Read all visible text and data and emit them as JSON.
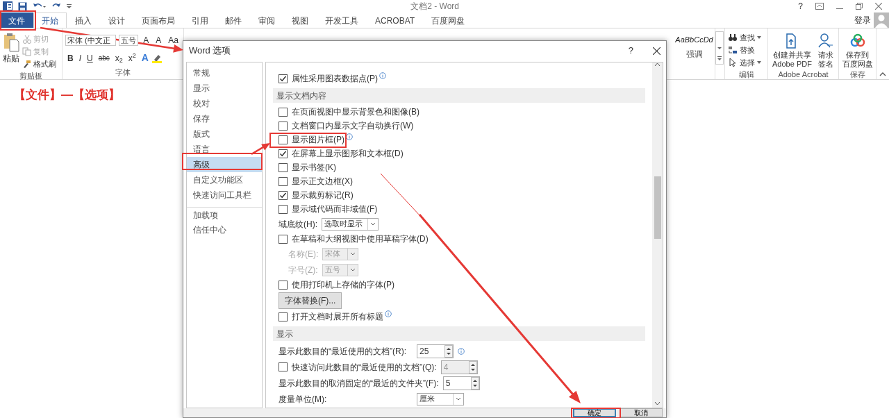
{
  "title_bar": {
    "title": "文档2 - Word",
    "help": "?"
  },
  "ribbon_tabs": [
    {
      "label": "文件",
      "kind": "file",
      "selected": false
    },
    {
      "label": "开始",
      "kind": "tab",
      "selected": true
    },
    {
      "label": "插入",
      "kind": "tab",
      "selected": false
    },
    {
      "label": "设计",
      "kind": "tab",
      "selected": false
    },
    {
      "label": "页面布局",
      "kind": "tab",
      "selected": false
    },
    {
      "label": "引用",
      "kind": "tab",
      "selected": false
    },
    {
      "label": "邮件",
      "kind": "tab",
      "selected": false
    },
    {
      "label": "审阅",
      "kind": "tab",
      "selected": false
    },
    {
      "label": "视图",
      "kind": "tab",
      "selected": false
    },
    {
      "label": "开发工具",
      "kind": "tab",
      "selected": false
    },
    {
      "label": "ACROBAT",
      "kind": "tab",
      "selected": false
    },
    {
      "label": "百度网盘",
      "kind": "tab",
      "selected": false
    }
  ],
  "account": {
    "label": "登录"
  },
  "clipboard": {
    "paste": "粘贴",
    "items": [
      {
        "label": "剪切",
        "disabled": true
      },
      {
        "label": "复制",
        "disabled": true
      },
      {
        "label": "格式刷",
        "disabled": false
      }
    ],
    "group": "剪贴板"
  },
  "font": {
    "name": "宋体 (中文正",
    "size": "五号",
    "size_buttons": [
      "A",
      "A",
      "Aa"
    ],
    "format_buttons": [
      "B",
      "I",
      "U",
      "abc",
      "x$_{2}$",
      "x$^{2}$",
      "A"
    ],
    "group": "字体"
  },
  "styles": {
    "sample": "AaBbCcDd",
    "name": "强调"
  },
  "editing": {
    "items": [
      "查找",
      "替换",
      "选择"
    ],
    "group": "编辑"
  },
  "acrobat": {
    "items": [
      {
        "lines": [
          "创建并共享",
          "Adobe PDF"
        ]
      },
      {
        "lines": [
          "请求",
          "签名"
        ]
      }
    ],
    "group": "Adobe Acrobat"
  },
  "save": {
    "lines": [
      "保存到",
      "百度网盘"
    ],
    "group": "保存"
  },
  "document": {
    "text": "【文件】—【选项】"
  },
  "dialog": {
    "title": "Word 选项",
    "help": "?",
    "nav": [
      {
        "label": "常规",
        "selected": false
      },
      {
        "label": "显示",
        "selected": false
      },
      {
        "label": "校对",
        "selected": false
      },
      {
        "label": "保存",
        "selected": false
      },
      {
        "label": "版式",
        "selected": false
      },
      {
        "label": "语言",
        "selected": false
      },
      {
        "label": "高级",
        "selected": true
      },
      {
        "label": "自定义功能区",
        "selected": false
      },
      {
        "label": "快速访问工具栏",
        "selected": false
      },
      {
        "label": "加载项",
        "selected": false,
        "divider_before": true
      },
      {
        "label": "信任中心",
        "selected": false
      }
    ],
    "sections": [
      {
        "rows": [
          {
            "kind": "checkbox",
            "label": "属性采用图表数据点(P)",
            "checked": true,
            "info": true
          }
        ]
      },
      {
        "title": "显示文档内容",
        "rows": [
          {
            "kind": "checkbox",
            "label": "在页面视图中显示背景色和图像(B)",
            "checked": false
          },
          {
            "kind": "checkbox",
            "label": "文档窗口内显示文字自动换行(W)",
            "checked": false
          },
          {
            "kind": "checkbox",
            "label": "显示图片框(P)",
            "checked": false,
            "info": true
          },
          {
            "kind": "checkbox",
            "label": "在屏幕上显示图形和文本框(D)",
            "checked": true
          },
          {
            "kind": "checkbox",
            "label": "显示书签(K)",
            "checked": false
          },
          {
            "kind": "checkbox",
            "label": "显示正文边框(X)",
            "checked": false
          },
          {
            "kind": "checkbox",
            "label": "显示裁剪标记(R)",
            "checked": true
          },
          {
            "kind": "checkbox",
            "label": "显示域代码而非域值(F)",
            "checked": false
          },
          {
            "kind": "select",
            "label": "域底纹(H):",
            "value": "选取时显示",
            "disabled": false
          },
          {
            "kind": "checkbox",
            "label": "在草稿和大纲视图中使用草稿字体(D)",
            "checked": false,
            "children": [
              {
                "kind": "select",
                "label": "名称(E):",
                "value": "宋体",
                "disabled": true
              },
              {
                "kind": "select",
                "label": "字号(Z):",
                "value": "五号",
                "disabled": true
              }
            ]
          },
          {
            "kind": "checkbox",
            "label": "使用打印机上存储的字体(P)",
            "checked": false
          },
          {
            "kind": "button",
            "label": "字体替换(F)..."
          },
          {
            "kind": "checkbox",
            "label": "打开文档时展开所有标题",
            "checked": false,
            "info": true
          }
        ]
      },
      {
        "title": "显示",
        "rows": [
          {
            "kind": "spin",
            "label": "显示此数目的“最近使用的文档”(R):",
            "value": "25",
            "disabled": false,
            "info": true
          },
          {
            "kind": "spin",
            "label": "快速访问此数目的“最近使用的文档”(Q):",
            "value": "4",
            "disabled": true,
            "checked": false
          },
          {
            "kind": "spin",
            "label": "显示此数目的取消固定的“最近的文件夹”(F):",
            "value": "5",
            "disabled": false
          },
          {
            "kind": "select",
            "label": "度量单位(M):",
            "value": "厘米",
            "disabled": false
          }
        ]
      }
    ],
    "buttons": [
      {
        "label": "确定",
        "default": true
      },
      {
        "label": "取消",
        "default": false
      }
    ]
  }
}
